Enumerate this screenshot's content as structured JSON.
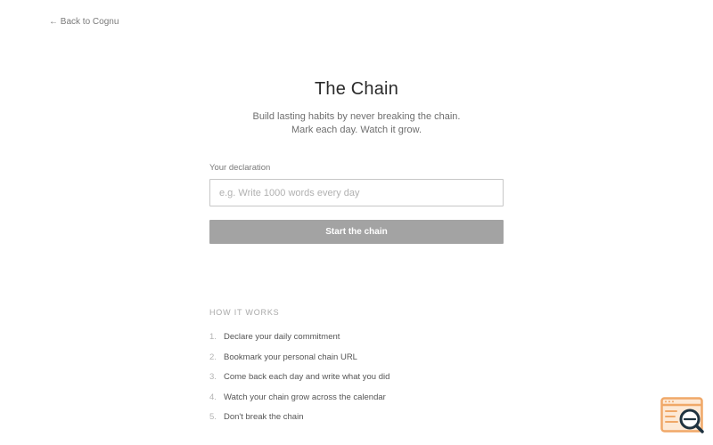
{
  "nav": {
    "back_label": "← Back to Cognu"
  },
  "header": {
    "title": "The Chain",
    "subtitle_line1": "Build lasting habits by never breaking the chain.",
    "subtitle_line2": "Mark each day. Watch it grow."
  },
  "form": {
    "declaration_label": "Your declaration",
    "declaration_placeholder": "e.g. Write 1000 words every day",
    "declaration_value": "",
    "start_label": "Start the chain"
  },
  "how_it_works": {
    "heading": "HOW IT WORKS",
    "steps": [
      {
        "num": "1.",
        "text": "Declare your daily commitment"
      },
      {
        "num": "2.",
        "text": "Bookmark your personal chain URL"
      },
      {
        "num": "3.",
        "text": "Come back each day and write what you did"
      },
      {
        "num": "4.",
        "text": "Watch your chain grow across the calendar"
      },
      {
        "num": "5.",
        "text": "Don't break the chain"
      }
    ]
  },
  "widget": {
    "icon": "browser-search-icon",
    "accent": "#f0a868",
    "dark": "#1f3340"
  },
  "colors": {
    "button_bg": "#a3a3a3",
    "input_border": "#c7c7c7"
  }
}
